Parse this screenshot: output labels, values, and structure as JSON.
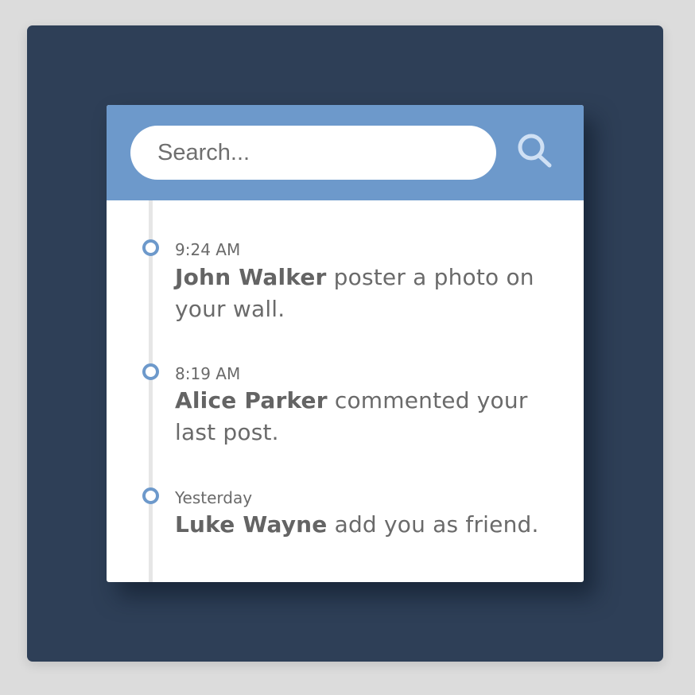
{
  "search": {
    "placeholder": "Search...",
    "icon": "search-icon"
  },
  "colors": {
    "backdrop": "#2e3f57",
    "header": "#6d99cb",
    "accent": "#6d99cb",
    "search_icon": "#cfe0f4"
  },
  "timeline": {
    "entries": [
      {
        "time": "9:24 AM",
        "name": "John Walker",
        "action": "poster a photo on your wall."
      },
      {
        "time": "8:19 AM",
        "name": "Alice Parker",
        "action": "commented your last post."
      },
      {
        "time": "Yesterday",
        "name": "Luke Wayne",
        "action": "add you as friend."
      }
    ]
  }
}
